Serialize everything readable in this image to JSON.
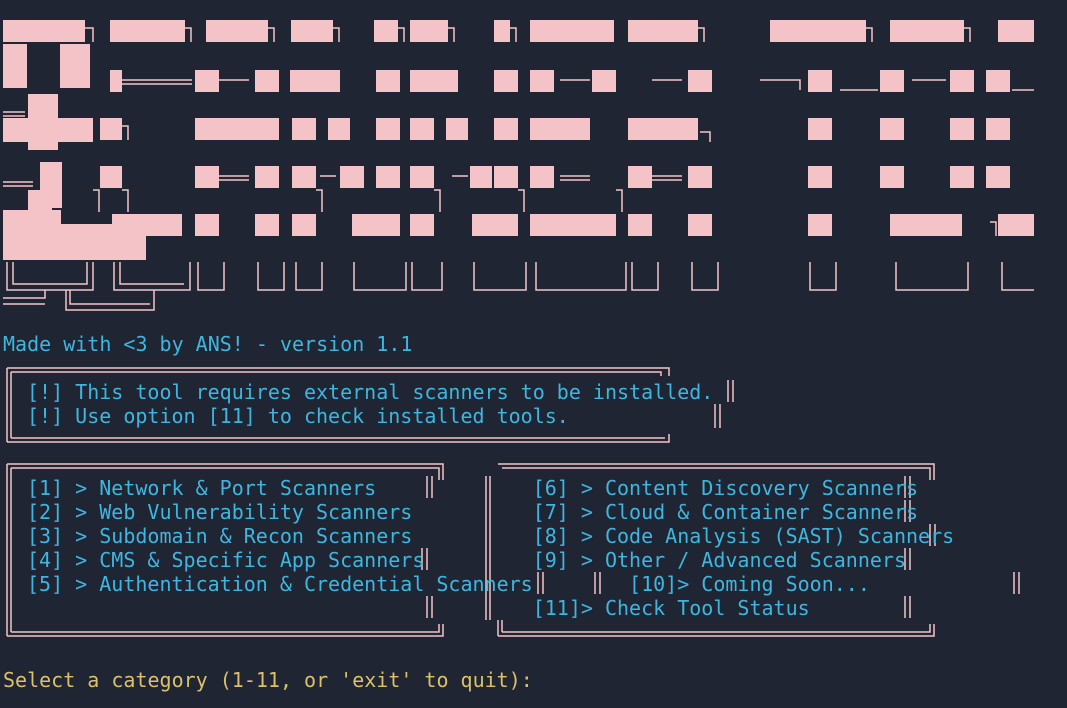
{
  "banner": {
    "art_text": "SECURITY SCANNER"
  },
  "credit_line": "Made with <3 by ANS! - version 1.1",
  "notice": {
    "line1": "[!] This tool requires external scanners to be installed.",
    "line2": "[!] Use option [11] to check installed tools."
  },
  "menu": {
    "rows": [
      "[1] > Network & Port Scanners             [6] > Content Discovery Scanners",
      "[2] > Web Vulnerability Scanners          [7] > Cloud & Container Scanners",
      "[3] > Subdomain & Recon Scanners          [8] > Code Analysis (SAST) Scanners",
      "[4] > CMS & Specific App Scanners         [9] > Other / Advanced Scanners",
      "[5] > Authentication & Credential Scanners        [10]> Coming Soon...",
      "                                          [11]> Check Tool Status"
    ]
  },
  "prompt": "Select a category (1-11, or 'exit' to quit):",
  "colors": {
    "background": "#1f2533",
    "banner_pink": "#f4c3c8",
    "text_cyan": "#3fb6e0",
    "prompt_yellow": "#dcc06a"
  }
}
